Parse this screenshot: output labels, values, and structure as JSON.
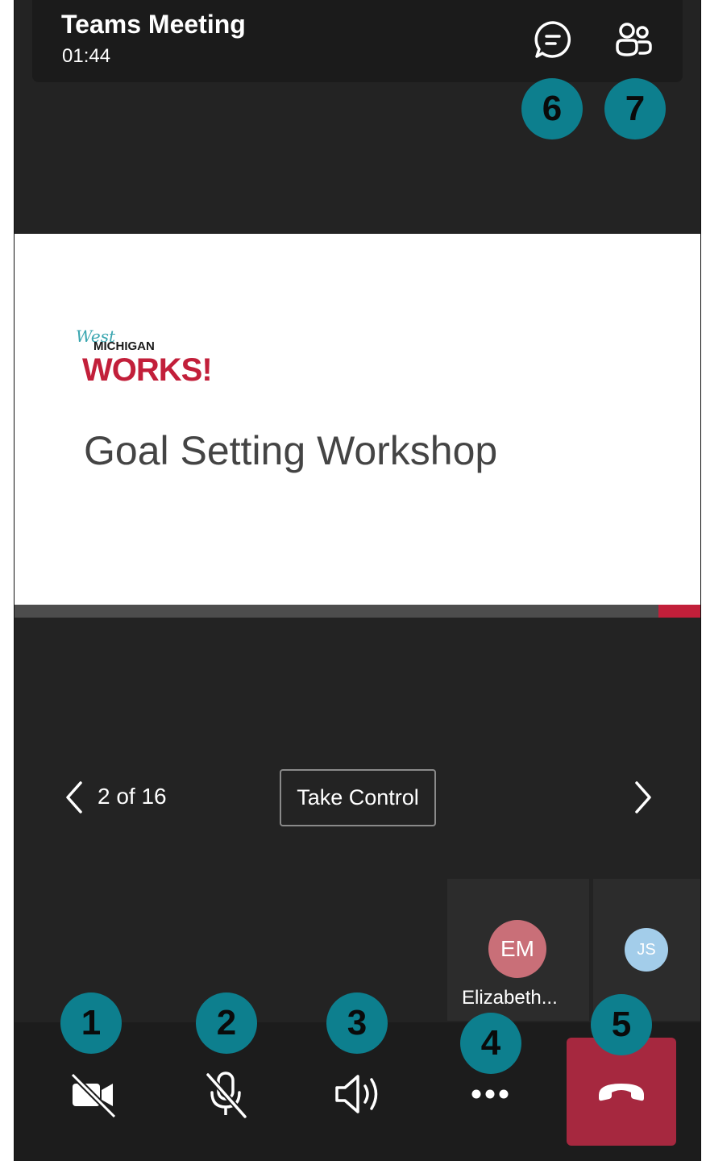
{
  "meeting": {
    "title": "Teams Meeting",
    "duration": "01:44"
  },
  "header_actions": [
    {
      "icon": "chat-icon",
      "callout": "6"
    },
    {
      "icon": "participants-icon",
      "callout": "7"
    }
  ],
  "slide": {
    "logo": {
      "west": "West",
      "michigan": "MICHIGAN",
      "works": "WORKS!"
    },
    "title": "Goal Setting Workshop",
    "current_page": 2,
    "total_pages": 16,
    "page_label": "2 of 16",
    "take_control_label": "Take Control"
  },
  "participants": [
    {
      "initials": "EM",
      "name": "Elizabeth...",
      "avatar_color": "#c96f78"
    },
    {
      "initials": "JS",
      "avatar_color": "#a3cdea"
    }
  ],
  "controls": [
    {
      "icon": "camera-off-icon",
      "callout": "1"
    },
    {
      "icon": "mic-off-icon",
      "callout": "2"
    },
    {
      "icon": "speaker-icon",
      "callout": "3"
    },
    {
      "icon": "more-options-icon",
      "callout": "4"
    },
    {
      "icon": "hang-up-icon",
      "callout": "5"
    }
  ],
  "colors": {
    "callout": "#0d7f8e",
    "hangup": "#a6283f",
    "brand_red": "#c21f3a"
  }
}
